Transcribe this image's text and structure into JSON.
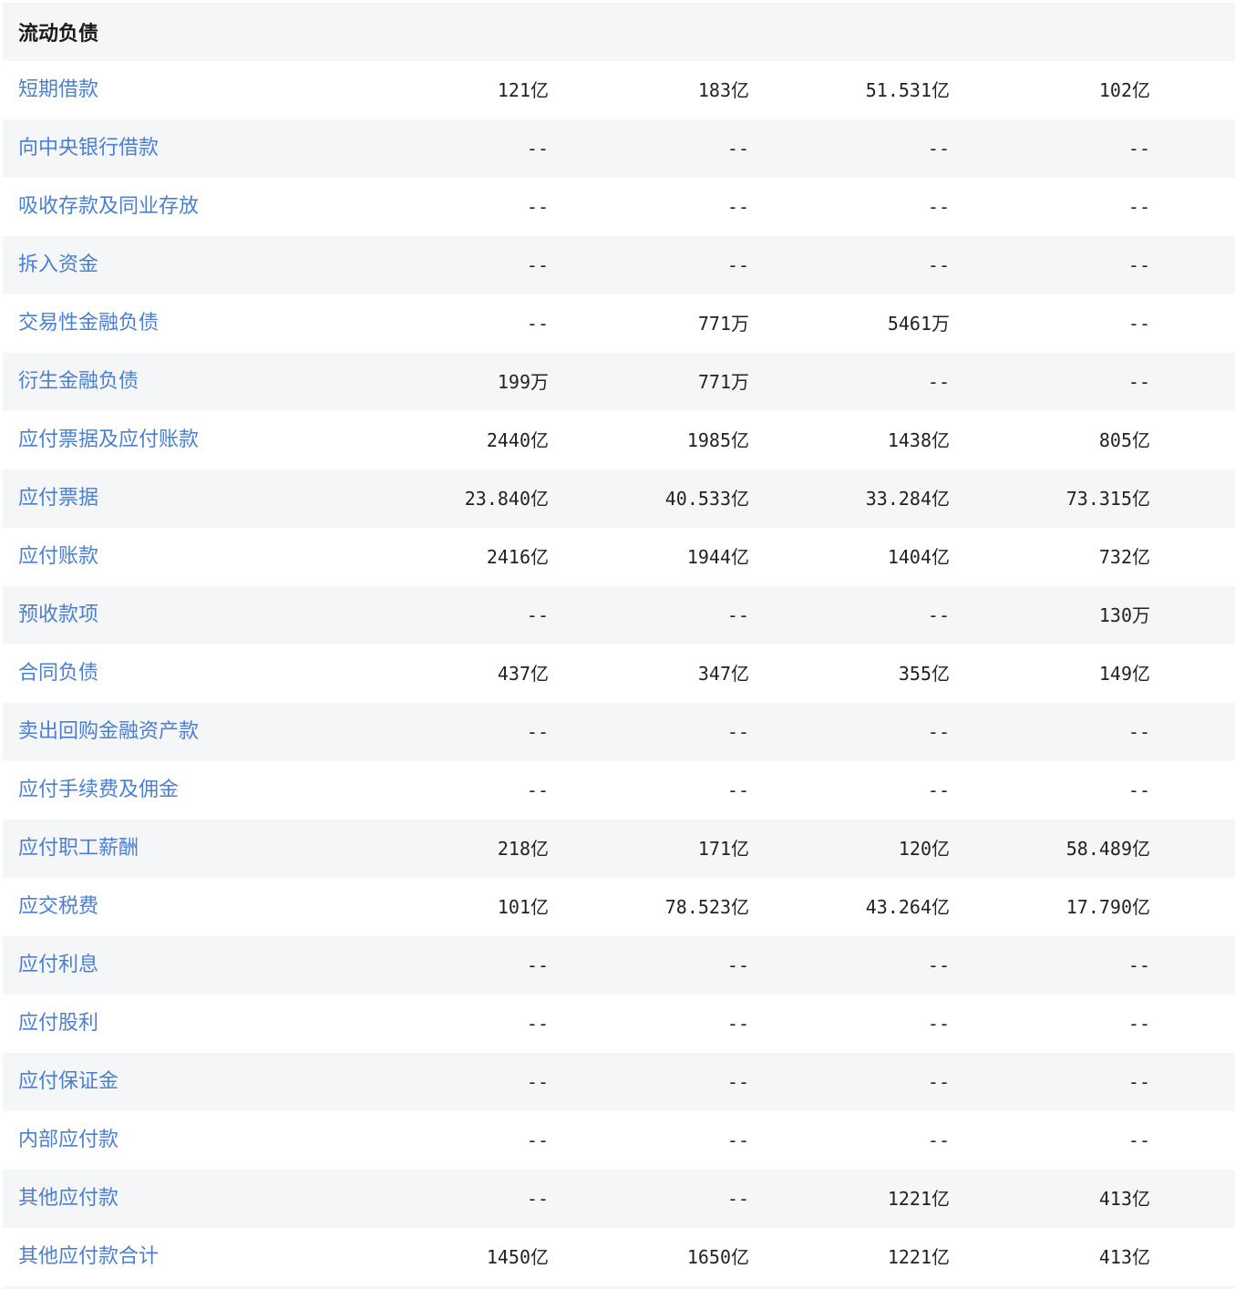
{
  "section": {
    "title": "流动负债"
  },
  "rows": [
    {
      "label": "短期借款",
      "values": [
        "121亿",
        "183亿",
        "51.531亿",
        "102亿"
      ]
    },
    {
      "label": "向中央银行借款",
      "values": [
        "--",
        "--",
        "--",
        "--"
      ]
    },
    {
      "label": "吸收存款及同业存放",
      "values": [
        "--",
        "--",
        "--",
        "--"
      ]
    },
    {
      "label": "拆入资金",
      "values": [
        "--",
        "--",
        "--",
        "--"
      ]
    },
    {
      "label": "交易性金融负债",
      "values": [
        "--",
        "771万",
        "5461万",
        "--"
      ]
    },
    {
      "label": "衍生金融负债",
      "values": [
        "199万",
        "771万",
        "--",
        "--"
      ]
    },
    {
      "label": "应付票据及应付账款",
      "values": [
        "2440亿",
        "1985亿",
        "1438亿",
        "805亿"
      ]
    },
    {
      "label": "应付票据",
      "values": [
        "23.840亿",
        "40.533亿",
        "33.284亿",
        "73.315亿"
      ]
    },
    {
      "label": "应付账款",
      "values": [
        "2416亿",
        "1944亿",
        "1404亿",
        "732亿"
      ]
    },
    {
      "label": "预收款项",
      "values": [
        "--",
        "--",
        "--",
        "130万"
      ]
    },
    {
      "label": "合同负债",
      "values": [
        "437亿",
        "347亿",
        "355亿",
        "149亿"
      ]
    },
    {
      "label": "卖出回购金融资产款",
      "values": [
        "--",
        "--",
        "--",
        "--"
      ]
    },
    {
      "label": "应付手续费及佣金",
      "values": [
        "--",
        "--",
        "--",
        "--"
      ]
    },
    {
      "label": "应付职工薪酬",
      "values": [
        "218亿",
        "171亿",
        "120亿",
        "58.489亿"
      ]
    },
    {
      "label": "应交税费",
      "values": [
        "101亿",
        "78.523亿",
        "43.264亿",
        "17.790亿"
      ]
    },
    {
      "label": "应付利息",
      "values": [
        "--",
        "--",
        "--",
        "--"
      ]
    },
    {
      "label": "应付股利",
      "values": [
        "--",
        "--",
        "--",
        "--"
      ]
    },
    {
      "label": "应付保证金",
      "values": [
        "--",
        "--",
        "--",
        "--"
      ]
    },
    {
      "label": "内部应付款",
      "values": [
        "--",
        "--",
        "--",
        "--"
      ]
    },
    {
      "label": "其他应付款",
      "values": [
        "--",
        "--",
        "1221亿",
        "413亿"
      ]
    },
    {
      "label": "其他应付款合计",
      "values": [
        "1450亿",
        "1650亿",
        "1221亿",
        "413亿"
      ]
    }
  ]
}
